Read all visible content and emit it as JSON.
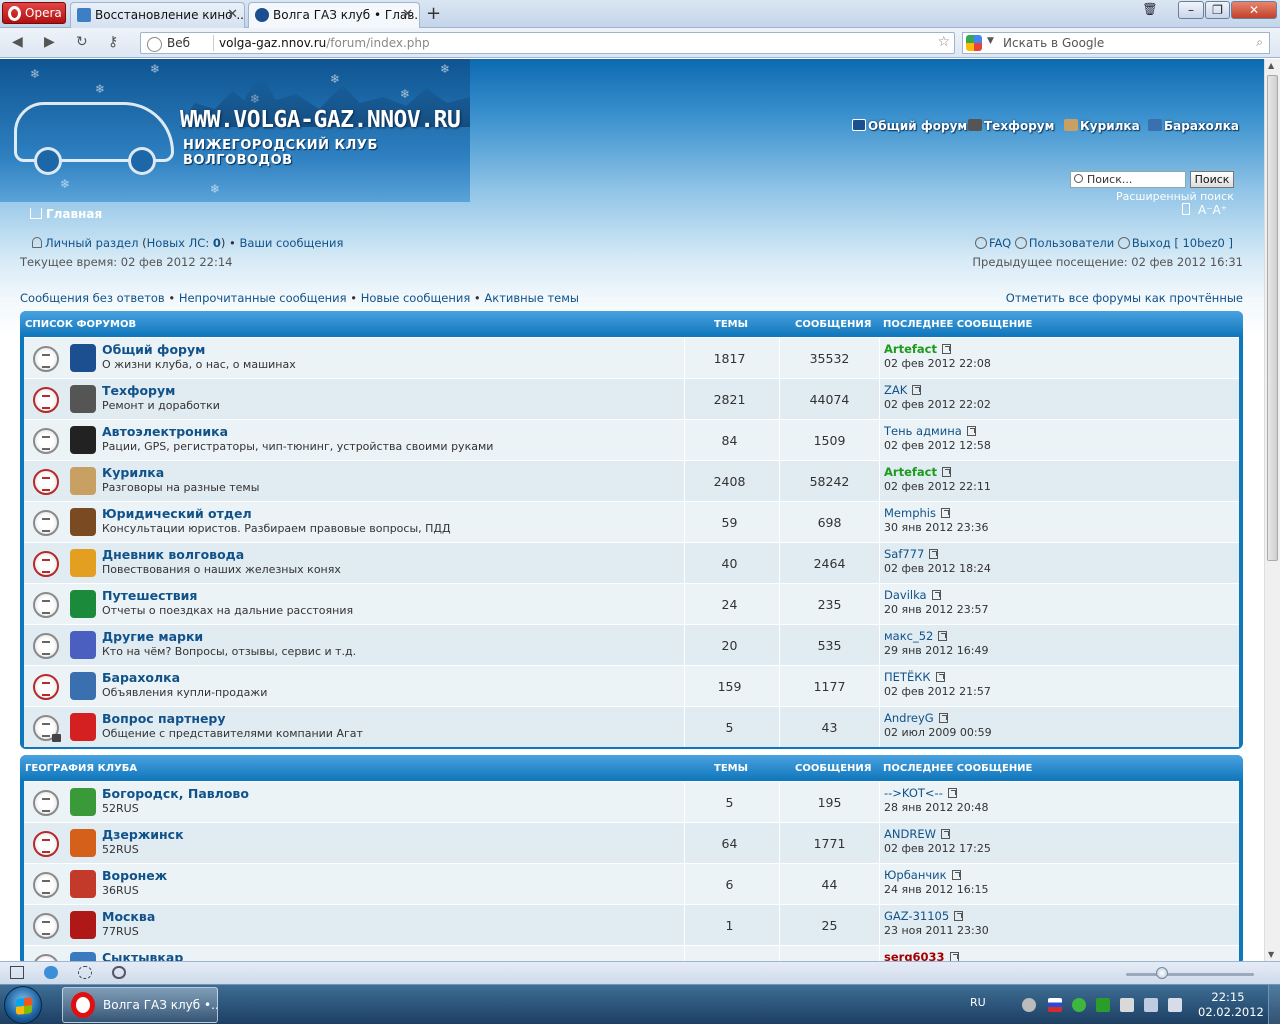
{
  "browser": {
    "menu_label": "Opera",
    "tabs": [
      {
        "title": "Восстановление кино ...",
        "icon": "blue-page-icon"
      },
      {
        "title": "Волга ГАЗ клуб • Глав...",
        "icon": "gaz-logo-icon"
      }
    ],
    "new_tab": "+",
    "address_web_label": "Веб",
    "url_host": "volga-gaz.nnov.ru",
    "url_path": "/forum/index.php",
    "search_placeholder": "Искать в Google"
  },
  "header": {
    "site_name": "WWW.VOLGA-GAZ.NNOV.RU",
    "club_name": "НИЖЕГОРОДСКИЙ КЛУБ ВОЛГОВОДОВ",
    "nav": [
      {
        "label": "Общий форум",
        "icon": "gaz-emblem-icon"
      },
      {
        "label": "Техфорум",
        "icon": "tools-icon"
      },
      {
        "label": "Курилка",
        "icon": "cigarette-icon"
      },
      {
        "label": "Барахолка",
        "icon": "truck-icon"
      }
    ],
    "search_placeholder": "Поиск...",
    "search_button": "Поиск",
    "advanced_search": "Расширенный поиск",
    "font_resize": "A⁻A⁺",
    "breadcrumb": "Главная"
  },
  "userbar": {
    "personal_section": "Личный раздел",
    "new_pm_prefix": "Новых ЛС:",
    "new_pm_count": "0",
    "your_posts": "Ваши сообщения",
    "faq": "FAQ",
    "users": "Пользователи",
    "logout": "Выход [ 10bez0 ]",
    "current_time": "Текущее время: 02 фев 2012 22:14",
    "last_visit": "Предыдущее посещение: 02 фев 2012 16:31"
  },
  "quicklinks": [
    "Сообщения без ответов",
    "Непрочитанные сообщения",
    "Новые сообщения",
    "Активные темы"
  ],
  "mark_read": "Отметить все форумы как прочтённые",
  "table_columns": {
    "topics": "ТЕМЫ",
    "posts": "СООБЩЕНИЯ",
    "last_post": "ПОСЛЕДНЕЕ СООБЩЕНИЕ"
  },
  "sections": [
    {
      "title": "СПИСОК ФОРУМОВ",
      "forums": [
        {
          "name": "Общий форум",
          "desc": "О жизни клуба, о нас, о машинах",
          "topics": "1817",
          "posts": "35532",
          "author": "Artefact",
          "author_style": "green",
          "date": "02 фев 2012 22:08",
          "unread": false,
          "icon": "gaz-emblem-icon",
          "icon_color": "#1c4f8f"
        },
        {
          "name": "Техфорум",
          "desc": "Ремонт и доработки",
          "topics": "2821",
          "posts": "44074",
          "author": "ZAK",
          "author_style": "normal",
          "date": "02 фев 2012 22:02",
          "unread": true,
          "icon": "tools-icon",
          "icon_color": "#555555"
        },
        {
          "name": "Автоэлектроника",
          "desc": "Рации, GPS, регистраторы, чип-тюнинг, устройства своими руками",
          "topics": "84",
          "posts": "1509",
          "author": "Тень админа",
          "author_style": "normal",
          "date": "02 фев 2012 12:58",
          "unread": false,
          "icon": "chip-icon",
          "icon_color": "#222222"
        },
        {
          "name": "Курилка",
          "desc": "Разговоры на разные темы",
          "topics": "2408",
          "posts": "58242",
          "author": "Artefact",
          "author_style": "green",
          "date": "02 фев 2012 22:11",
          "unread": true,
          "icon": "cigarette-icon",
          "icon_color": "#c9a063"
        },
        {
          "name": "Юридический отдел",
          "desc": "Консультации юристов. Разбираем правовые вопросы, ПДД",
          "topics": "59",
          "posts": "698",
          "author": "Memphis",
          "author_style": "normal",
          "date": "30 янв 2012 23:36",
          "unread": false,
          "icon": "gavel-icon",
          "icon_color": "#7a4a22"
        },
        {
          "name": "Дневник волговода",
          "desc": "Повествования о наших железных конях",
          "topics": "40",
          "posts": "2464",
          "author": "Saf777",
          "author_style": "normal",
          "date": "02 фев 2012 18:24",
          "unread": true,
          "icon": "pencils-icon",
          "icon_color": "#e3a020"
        },
        {
          "name": "Путешествия",
          "desc": "Отчеты о поездках на дальние расстояния",
          "topics": "24",
          "posts": "235",
          "author": "Davilka",
          "author_style": "normal",
          "date": "20 янв 2012 23:57",
          "unread": false,
          "icon": "road-icon",
          "icon_color": "#1b8a3a"
        },
        {
          "name": "Другие марки",
          "desc": "Кто на чём? Вопросы, отзывы, сервис и т.д.",
          "topics": "20",
          "posts": "535",
          "author": "макс_52",
          "author_style": "normal",
          "date": "29 янв 2012 16:49",
          "unread": false,
          "icon": "car-icon",
          "icon_color": "#4a5fc0"
        },
        {
          "name": "Барахолка",
          "desc": "Объявления купли-продажи",
          "topics": "159",
          "posts": "1177",
          "author": "ПЕТЁКК",
          "author_style": "normal",
          "date": "02 фев 2012 21:57",
          "unread": true,
          "icon": "truck-icon",
          "icon_color": "#3a6fb0"
        },
        {
          "name": "Вопрос партнеру",
          "desc": "Общение с представителями компании Агат",
          "topics": "5",
          "posts": "43",
          "author": "AndreyG",
          "author_style": "normal",
          "date": "02 июл 2009 00:59",
          "unread": false,
          "locked": true,
          "icon": "agat-logo-icon",
          "icon_color": "#d42020"
        }
      ]
    },
    {
      "title": "ГЕОГРАФИЯ КЛУБА",
      "forums": [
        {
          "name": "Богородск, Павлово",
          "desc": "52RUS",
          "topics": "5",
          "posts": "195",
          "author": "-->KOT<--",
          "author_style": "normal",
          "date": "28 янв 2012 20:48",
          "unread": false,
          "icon": "coat-of-arms-icon",
          "icon_color": "#3a9a3a"
        },
        {
          "name": "Дзержинск",
          "desc": "52RUS",
          "topics": "64",
          "posts": "1771",
          "author": "ANDREW",
          "author_style": "normal",
          "date": "02 фев 2012 17:25",
          "unread": true,
          "icon": "coat-of-arms-icon",
          "icon_color": "#d4601a"
        },
        {
          "name": "Воронеж",
          "desc": "36RUS",
          "topics": "6",
          "posts": "44",
          "author": "Юрбанчик",
          "author_style": "normal",
          "date": "24 янв 2012 16:15",
          "unread": false,
          "icon": "coat-of-arms-icon",
          "icon_color": "#c43a2a"
        },
        {
          "name": "Москва",
          "desc": "77RUS",
          "topics": "1",
          "posts": "25",
          "author": "GAZ-31105",
          "author_style": "normal",
          "date": "23 ноя 2011 23:30",
          "unread": false,
          "icon": "coat-of-arms-icon",
          "icon_color": "#b01818"
        },
        {
          "name": "Сыктывкар",
          "desc": "",
          "topics": "",
          "posts": "",
          "author": "serg6033",
          "author_style": "red",
          "date": "",
          "unread": false,
          "icon": "coat-of-arms-icon",
          "icon_color": "#3a7ac0"
        }
      ]
    }
  ],
  "panel": {
    "zoom_level": 0.28
  },
  "taskbar": {
    "item": "Волга ГАЗ клуб •...",
    "lang": "RU",
    "time": "22:15",
    "date": "02.02.2012"
  }
}
